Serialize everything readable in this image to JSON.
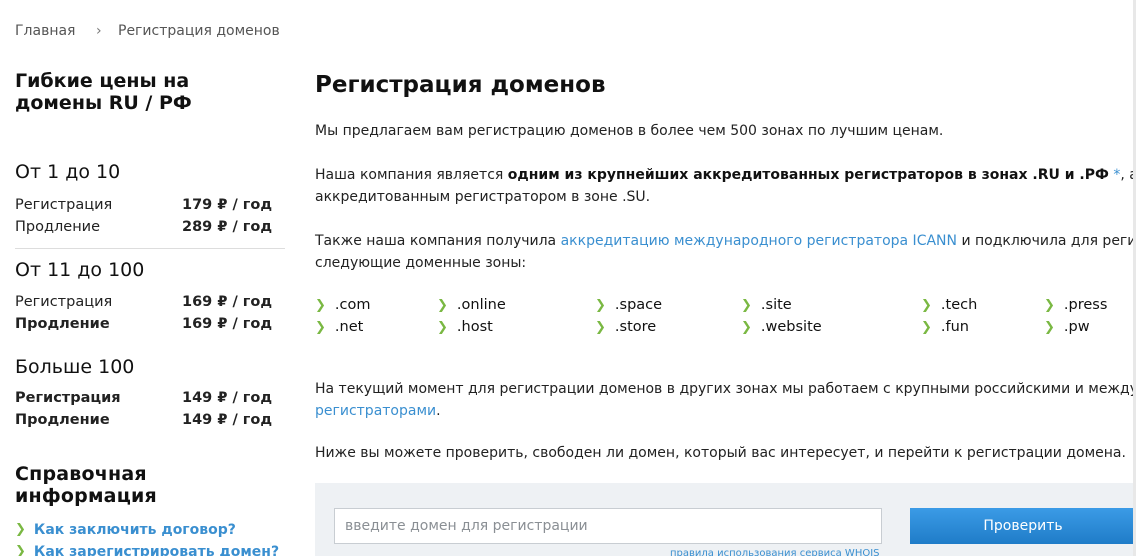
{
  "breadcrumb": {
    "home": "Главная",
    "separator": "›",
    "current": "Регистрация доменов"
  },
  "sidebar": {
    "heading": "Гибкие цены на домены RU / РФ",
    "tiers": [
      {
        "title": "От 1 до 10",
        "rows": [
          {
            "label": "Регистрация",
            "price": "179 ₽ / год"
          },
          {
            "label": "Продление",
            "price": "289 ₽ / год"
          }
        ]
      },
      {
        "title": "От 11 до 100",
        "rows": [
          {
            "label": "Регистрация",
            "price": "169 ₽ / год"
          },
          {
            "label": "Продление",
            "price": "169 ₽ / год"
          }
        ]
      },
      {
        "title": "Больше 100",
        "rows": [
          {
            "label": "Регистрация",
            "price": "149 ₽ / год"
          },
          {
            "label": "Продление",
            "price": "149 ₽ / год"
          }
        ]
      }
    ],
    "info_title": "Справочная информация",
    "info_links": [
      "Как заключить договор?",
      "Как зарегистрировать домен?"
    ]
  },
  "main": {
    "title": "Регистрация доменов",
    "p1": "Мы предлагаем вам регистрацию доменов в более чем 500 зонах по лучшим ценам.",
    "p2_pre": "Наша компания является ",
    "p2_bold": "одним из крупнейших аккредитованных регистраторов в зонах .RU и .РФ",
    "p2_ast": " *",
    "p2_post": ", а также",
    "p2_line2": "аккредитованным регистратором в зоне .SU.",
    "p3_pre": "Также наша компания получила ",
    "p3_link": "аккредитацию международного регистратора ICANN",
    "p3_post": " и подключила для регистрации",
    "p3_line2": "следующие доменные зоны:",
    "zones": [
      ".com",
      ".net",
      ".online",
      ".host",
      ".space",
      ".store",
      ".site",
      ".website",
      ".tech",
      ".fun",
      ".press",
      ".pw"
    ],
    "p4_line1": "На текущий момент для регистрации доменов в других зонах мы работаем с крупными российскими и международн",
    "p4_link": "регистраторами",
    "p4_end": ".",
    "p5": "Ниже вы можете проверить, свободен ли домен, который вас интересует, и перейти к регистрации домена."
  },
  "search": {
    "placeholder": "введите домен для регистрации",
    "button": "Проверить",
    "whois_link": "правила использования сервиса WHOIS"
  },
  "colors": {
    "link": "#3a8fd0",
    "chevron": "#7ab843",
    "button": "#2a8ad8",
    "search_bg": "#eef1f4"
  }
}
